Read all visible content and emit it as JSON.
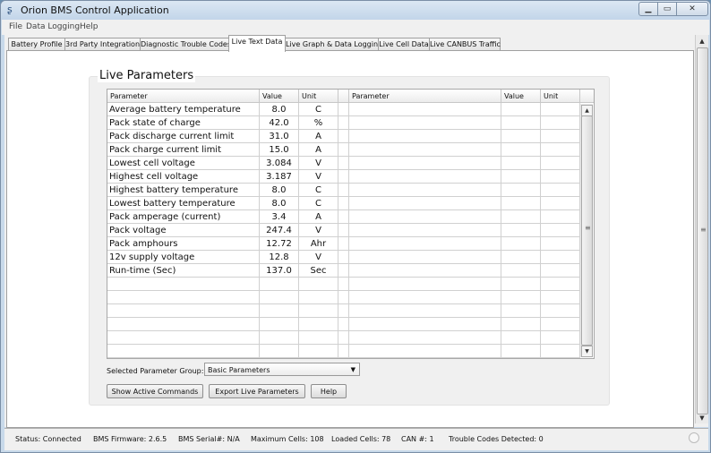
{
  "window": {
    "title": "Orion BMS Control Application",
    "minimize": "▁",
    "maximize": "▭",
    "close": "✕"
  },
  "menu": [
    "File",
    "Data Logging",
    "Help"
  ],
  "tabs": [
    "Battery Profile",
    "3rd Party Integration",
    "Diagnostic Trouble Codes",
    "Live Text Data",
    "Live Graph & Data Logging",
    "Live Cell Data",
    "Live CANBUS Traffic"
  ],
  "active_tab": "Live Text Data",
  "panel": {
    "title": "Live Parameters"
  },
  "table": {
    "headers": [
      "Parameter",
      "Value",
      "Unit",
      "Parameter",
      "Value",
      "Unit"
    ],
    "rows": [
      [
        "Average battery temperature",
        "8.0",
        "C"
      ],
      [
        "Pack state of charge",
        "42.0",
        "%"
      ],
      [
        "Pack discharge current limit",
        "31.0",
        "A"
      ],
      [
        "Pack charge current limit",
        "15.0",
        "A"
      ],
      [
        "Lowest cell voltage",
        "3.084",
        "V"
      ],
      [
        "Highest cell voltage",
        "3.187",
        "V"
      ],
      [
        "Highest battery temperature",
        "8.0",
        "C"
      ],
      [
        "Lowest battery temperature",
        "8.0",
        "C"
      ],
      [
        "Pack amperage (current)",
        "3.4",
        "A"
      ],
      [
        "Pack voltage",
        "247.4",
        "V"
      ],
      [
        "Pack amphours",
        "12.72",
        "Ahr"
      ],
      [
        "12v supply voltage",
        "12.8",
        "V"
      ],
      [
        "Run-time (Sec)",
        "137.0",
        "Sec"
      ]
    ]
  },
  "parameter_group": {
    "label": "Selected Parameter Group:",
    "value": "Basic Parameters"
  },
  "buttons": {
    "show_active": "Show Active Commands",
    "export": "Export Live Parameters",
    "help": "Help"
  },
  "status": {
    "connection": "Status: Connected",
    "firmware": "BMS Firmware: 2.6.5",
    "serial": "BMS Serial#: N/A",
    "max_cells": "Maximum Cells: 108",
    "loaded_cells": "Loaded Cells: 78",
    "can": "CAN #: 1",
    "trouble_codes": "Trouble Codes Detected: 0"
  }
}
